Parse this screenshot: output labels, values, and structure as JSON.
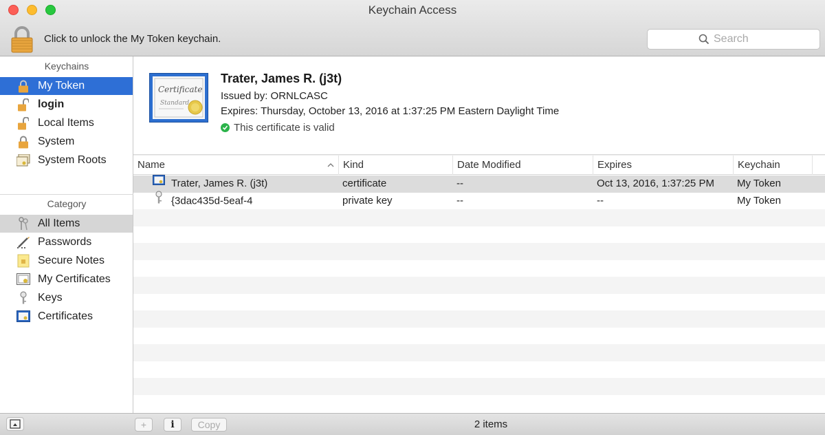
{
  "window": {
    "title": "Keychain Access",
    "unlock_text": "Click to unlock the My Token keychain.",
    "search_placeholder": "Search"
  },
  "sidebar": {
    "keychains_header": "Keychains",
    "keychains": [
      {
        "label": "My Token",
        "icon": "lock-icon"
      },
      {
        "label": "login",
        "icon": "unlocked-icon"
      },
      {
        "label": "Local Items",
        "icon": "unlocked-icon"
      },
      {
        "label": "System",
        "icon": "lock-icon"
      },
      {
        "label": "System Roots",
        "icon": "certificate-stack-icon"
      }
    ],
    "category_header": "Category",
    "categories": [
      {
        "label": "All Items",
        "icon": "keys-icon"
      },
      {
        "label": "Passwords",
        "icon": "pen-icon"
      },
      {
        "label": "Secure Notes",
        "icon": "note-icon"
      },
      {
        "label": "My Certificates",
        "icon": "my-certificate-icon"
      },
      {
        "label": "Keys",
        "icon": "key-icon"
      },
      {
        "label": "Certificates",
        "icon": "certificate-icon"
      }
    ]
  },
  "detail": {
    "name": "Trater, James R. (j3t)",
    "issued_by": "Issued by: ORNLCASC",
    "expires": "Expires: Thursday, October 13, 2016 at 1:37:25 PM Eastern Daylight Time",
    "status": "This certificate is valid"
  },
  "table": {
    "columns": [
      "Name",
      "Kind",
      "Date Modified",
      "Expires",
      "Keychain"
    ],
    "rows": [
      {
        "name": "Trater, James R. (j3t)",
        "kind": "certificate",
        "date_modified": "--",
        "expires": "Oct 13, 2016, 1:37:25 PM",
        "keychain": "My Token",
        "icon": "certificate-icon"
      },
      {
        "name": "{3dac435d-5eaf-4",
        "kind": "private key",
        "date_modified": "--",
        "expires": "--",
        "keychain": "My Token",
        "icon": "key-icon"
      }
    ]
  },
  "bottombar": {
    "copy_label": "Copy",
    "info_label": "i",
    "add_label": "+",
    "item_count": "2 items"
  },
  "colors": {
    "selection_blue": "#2e6fd6",
    "valid_green": "#2bb34a",
    "lock_gold": "#e3a33c"
  }
}
